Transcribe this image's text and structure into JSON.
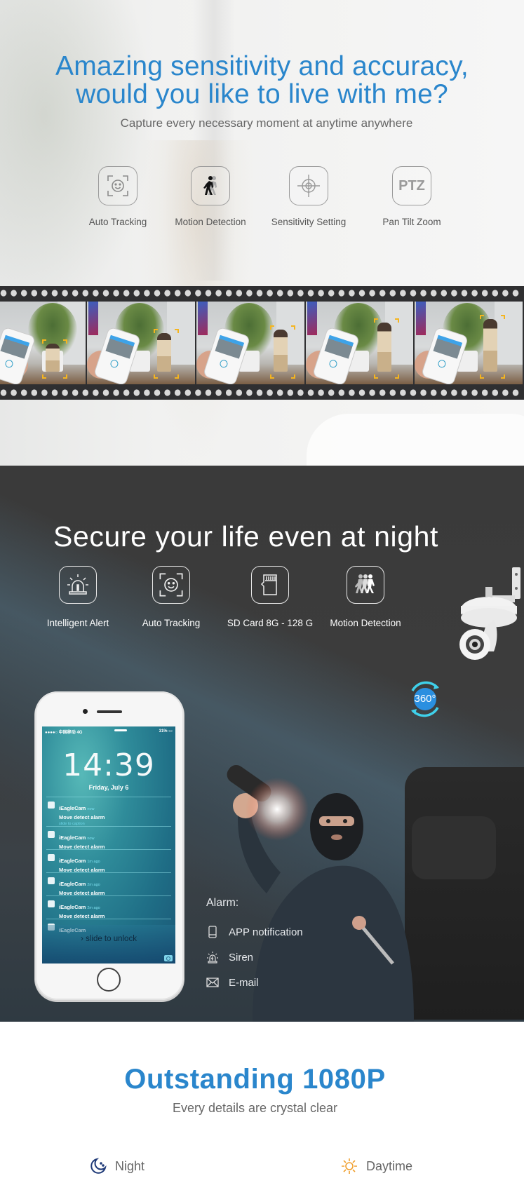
{
  "section_sensitivity": {
    "title_line1": "Amazing sensitivity and accuracy,",
    "title_line2": "would you like to live with me?",
    "subtitle": "Capture every necessary moment at anytime anywhere",
    "features": [
      {
        "label": "Auto Tracking",
        "icon": "face-tracking-icon"
      },
      {
        "label": "Motion Detection",
        "icon": "walking-person-icon"
      },
      {
        "label": "Sensitivity Setting",
        "icon": "crosshair-icon"
      },
      {
        "label": "Pan Tilt Zoom",
        "icon": "ptz-icon",
        "icon_text": "PTZ"
      }
    ],
    "film_frames": 5
  },
  "section_night": {
    "title": "Secure your life even at night",
    "features": [
      {
        "label": "Intelligent Alert",
        "icon": "alarm-light-icon"
      },
      {
        "label": "Auto Tracking",
        "icon": "face-tracking-icon"
      },
      {
        "label": "SD Card 8G - 128 G",
        "icon": "sd-card-icon"
      },
      {
        "label": "Motion Detection",
        "icon": "group-walking-icon"
      }
    ],
    "badge_360": "360°",
    "phone": {
      "status_left": "●●●●○ 中国移动  4G",
      "status_right": "31%",
      "time": "14:39",
      "date": "Friday, July 6",
      "notifications": [
        {
          "app": "iEagleCam",
          "when": "now",
          "message": "Move detect alarm",
          "hint": "slide to caption"
        },
        {
          "app": "iEagleCam",
          "when": "now",
          "message": "Move detect alarm"
        },
        {
          "app": "iEagleCam",
          "when": "1m ago",
          "message": "Move detect alarm"
        },
        {
          "app": "iEagleCam",
          "when": "2m ago",
          "message": "Move detect alarm"
        },
        {
          "app": "iEagleCam",
          "when": "2m ago",
          "message": "Move detect alarm"
        },
        {
          "app": "iEagleCam",
          "when": "",
          "message": ""
        }
      ],
      "unlock_text": "slide to unlock"
    },
    "alarm": {
      "heading": "Alarm:",
      "items": [
        {
          "label": "APP notification",
          "icon": "phone-icon"
        },
        {
          "label": "Siren",
          "icon": "siren-icon"
        },
        {
          "label": "E-mail",
          "icon": "envelope-icon"
        }
      ]
    }
  },
  "section_1080p": {
    "title": "Outstanding 1080P",
    "subtitle": "Every details are crystal clear",
    "modes": [
      {
        "label": "Night",
        "icon": "moon-icon",
        "color": "#1f3a78"
      },
      {
        "label": "Daytime",
        "icon": "sun-icon",
        "color": "#f0a030"
      }
    ]
  },
  "colors": {
    "accent_blue": "#2a86cc",
    "badge_cyan": "#3fd0ea"
  }
}
